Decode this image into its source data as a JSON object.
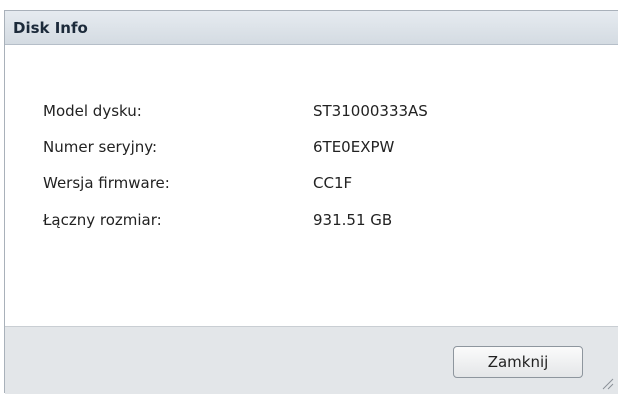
{
  "window": {
    "title": "Disk Info"
  },
  "disk_info": {
    "rows": [
      {
        "label": "Model dysku:",
        "value": "ST31000333AS"
      },
      {
        "label": "Numer seryjny:",
        "value": "6TE0EXPW"
      },
      {
        "label": "Wersja firmware:",
        "value": "CC1F"
      },
      {
        "label": "Łączny rozmiar:",
        "value": "931.51 GB"
      }
    ]
  },
  "footer": {
    "close_label": "Zamknij"
  },
  "icons": {
    "resize": "resize-grip-icon"
  }
}
